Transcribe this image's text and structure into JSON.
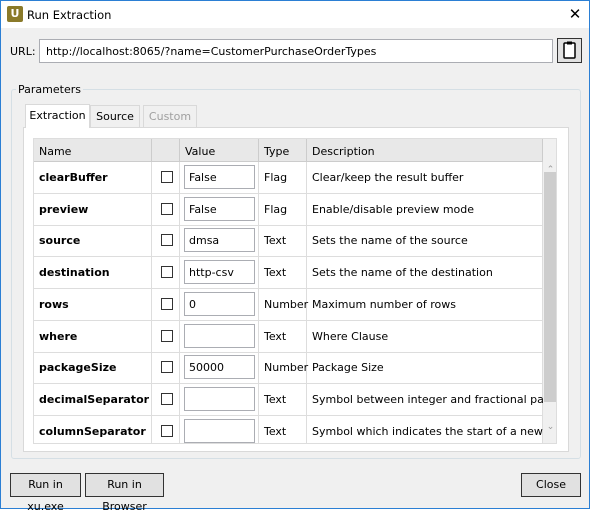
{
  "window": {
    "title": "Run Extraction",
    "logo": "U"
  },
  "url": {
    "label": "URL:",
    "value": "http://localhost:8065/?name=CustomerPurchaseOrderTypes"
  },
  "parameters": {
    "label": "Parameters",
    "tabs": [
      {
        "label": "Extraction",
        "state": "active"
      },
      {
        "label": "Source",
        "state": "normal"
      },
      {
        "label": "Custom",
        "state": "disabled"
      }
    ],
    "columns": [
      "Name",
      "",
      "Value",
      "Type",
      "Description"
    ],
    "rows": [
      {
        "name": "clearBuffer",
        "checked": false,
        "value": "False",
        "type": "Flag",
        "description": "Clear/keep the result buffer"
      },
      {
        "name": "preview",
        "checked": false,
        "value": "False",
        "type": "Flag",
        "description": "Enable/disable preview mode"
      },
      {
        "name": "source",
        "checked": false,
        "value": "dmsa",
        "type": "Text",
        "description": "Sets the name of the source"
      },
      {
        "name": "destination",
        "checked": false,
        "value": "http-csv",
        "type": "Text",
        "description": "Sets the name of the destination"
      },
      {
        "name": "rows",
        "checked": false,
        "value": "0",
        "type": "Number",
        "description": "Maximum number of rows"
      },
      {
        "name": "where",
        "checked": false,
        "value": "",
        "type": "Text",
        "description": "Where Clause"
      },
      {
        "name": "packageSize",
        "checked": false,
        "value": "50000",
        "type": "Number",
        "description": "Package Size"
      },
      {
        "name": "decimalSeparator",
        "checked": false,
        "value": "",
        "type": "Text",
        "description": "Symbol between integer and fractional part"
      },
      {
        "name": "columnSeparator",
        "checked": false,
        "value": "",
        "type": "Text",
        "description": "Symbol which indicates the start of a new column"
      }
    ]
  },
  "buttons": {
    "run_xu": "Run in xu.exe",
    "run_browser": "Run in Browser",
    "close": "Close"
  },
  "icons": {
    "close": "close-icon",
    "clipboard": "clipboard-icon"
  }
}
